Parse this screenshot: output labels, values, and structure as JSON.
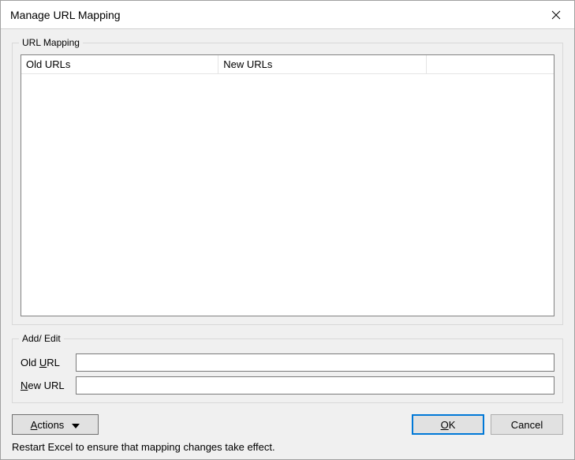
{
  "titlebar": {
    "title": "Manage URL Mapping"
  },
  "groups": {
    "url_mapping": {
      "legend": "URL Mapping",
      "columns": {
        "old": "Old URLs",
        "new": "New URLs",
        "extra": ""
      },
      "rows": []
    },
    "add_edit": {
      "legend": "Add/ Edit",
      "old_url_label": "Old URL",
      "new_url_label": "New URL",
      "old_url_value": "",
      "new_url_value": ""
    }
  },
  "buttons": {
    "actions": "Actions",
    "ok": "OK",
    "cancel": "Cancel"
  },
  "status_text": "Restart Excel to ensure that mapping changes take effect."
}
